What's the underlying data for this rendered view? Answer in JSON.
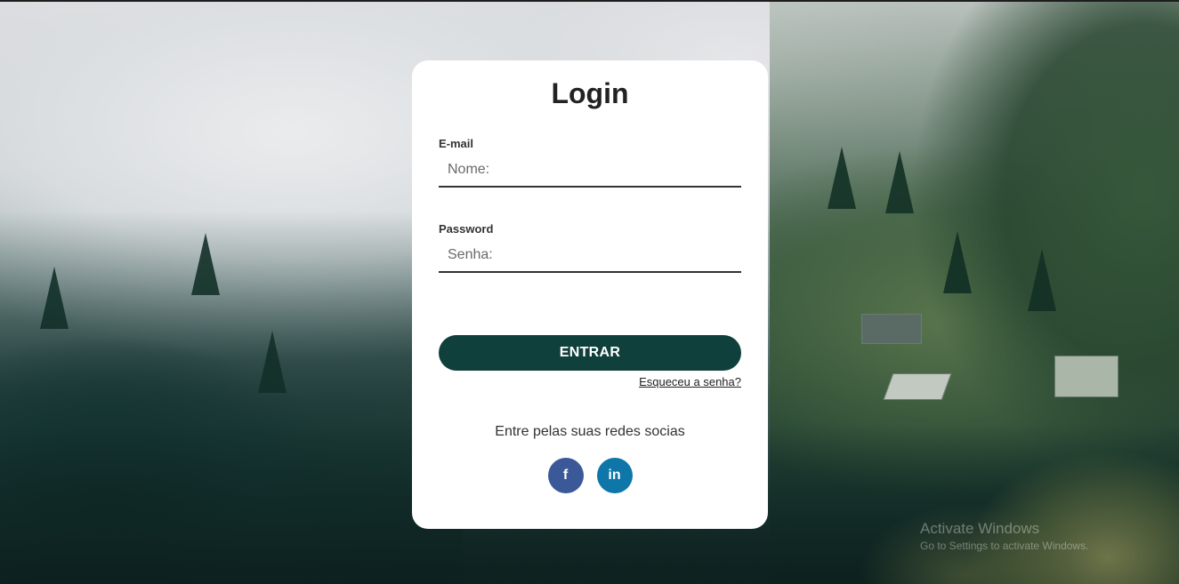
{
  "login": {
    "title": "Login",
    "email": {
      "label": "E-mail",
      "placeholder": "Nome:"
    },
    "password": {
      "label": "Password",
      "placeholder": "Senha:"
    },
    "submit_label": "ENTRAR",
    "forgot_label": "Esqueceu a senha?",
    "social_text": "Entre pelas suas redes socias",
    "social": [
      {
        "name": "facebook",
        "glyph": "f",
        "color": "#3b5998",
        "icon": "facebook-icon"
      },
      {
        "name": "linkedin",
        "glyph": "in",
        "color": "#0e76a8",
        "icon": "linkedin-icon"
      }
    ],
    "button_color": "#10403c"
  },
  "watermark": {
    "title": "Activate Windows",
    "subtitle": "Go to Settings to activate Windows."
  }
}
